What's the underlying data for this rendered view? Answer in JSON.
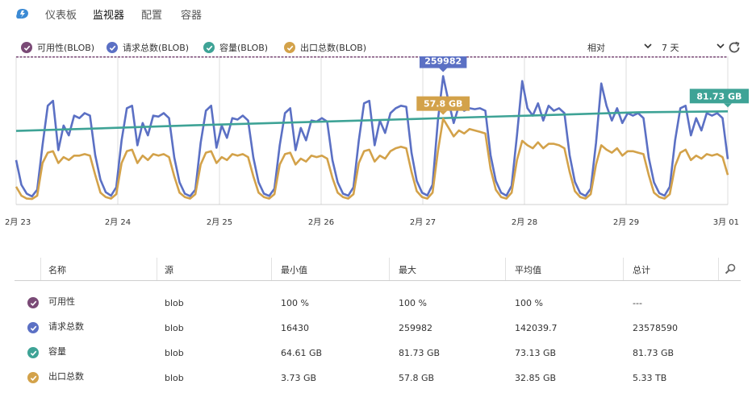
{
  "nav": {
    "tabs": [
      "仪表板",
      "监视器",
      "配置",
      "容器"
    ],
    "active": 1
  },
  "legend": [
    {
      "label": "可用性(BLOB)",
      "color": "#7a4a76"
    },
    {
      "label": "请求总数(BLOB)",
      "color": "#5b70c4"
    },
    {
      "label": "容量(BLOB)",
      "color": "#3ea396"
    },
    {
      "label": "出口总数(BLOB)",
      "color": "#d3a24a"
    }
  ],
  "controls": {
    "mode": "相对",
    "range": "7 天"
  },
  "chart_data": {
    "type": "line",
    "x_ticks": [
      "2月 23",
      "2月 24",
      "2月 25",
      "2月 26",
      "2月 27",
      "2月 28",
      "2月 29",
      "3月 01"
    ],
    "series": [
      {
        "name": "可用性(BLOB)",
        "unit": "%",
        "values": [
          100,
          100,
          100,
          100,
          100,
          100,
          100,
          100,
          100,
          100,
          100,
          100,
          100,
          100,
          100,
          100
        ]
      },
      {
        "name": "请求总数(BLOB)",
        "values": [
          90000,
          40000,
          22000,
          16430,
          30000,
          120000,
          200000,
          210000,
          110000,
          160000,
          140000,
          180000,
          175000,
          185000,
          180000,
          100000,
          50000,
          25000,
          18000,
          35000,
          130000,
          195000,
          200000,
          120000,
          165000,
          140000,
          180000,
          178000,
          185000,
          175000,
          95000,
          45000,
          22000,
          17000,
          30000,
          125000,
          190000,
          200000,
          115000,
          160000,
          135000,
          175000,
          172000,
          180000,
          170000,
          95000,
          45000,
          22000,
          17500,
          32000,
          120000,
          185000,
          195000,
          110000,
          155000,
          130000,
          170000,
          168000,
          175000,
          168000,
          90000,
          45000,
          22000,
          18000,
          35000,
          130000,
          205000,
          210000,
          120000,
          170000,
          145000,
          185000,
          195000,
          200000,
          198000,
          105000,
          48000,
          24000,
          18500,
          40000,
          170000,
          259982,
          210000,
          165000,
          200000,
          190000,
          195000,
          193000,
          195000,
          190000,
          100000,
          48000,
          24000,
          18000,
          38000,
          140000,
          250000,
          195000,
          180000,
          205000,
          170000,
          200000,
          190000,
          195000,
          185000,
          100000,
          46000,
          23000,
          17500,
          32000,
          125000,
          245000,
          200000,
          170000,
          195000,
          165000,
          185000,
          180000,
          185000,
          175000,
          95000,
          45000,
          23000,
          18000,
          36000,
          130000,
          195000,
          200000,
          140000,
          175000,
          150000,
          185000,
          180000,
          185000,
          175000,
          92000
        ]
      },
      {
        "name": "容量(BLOB)",
        "unit": "GB",
        "values": [
          64.61,
          67.0,
          69.5,
          71.8,
          74.0,
          76.3,
          78.6,
          81.0,
          81.73
        ]
      },
      {
        "name": "出口总数(BLOB)",
        "unit": "GB",
        "values": [
          12,
          6,
          4,
          3.73,
          6,
          28,
          35,
          36,
          28,
          32,
          30,
          33,
          33,
          34,
          33,
          20,
          8,
          5,
          4,
          7,
          28,
          36,
          37,
          28,
          33,
          30,
          34,
          33,
          34,
          32,
          19,
          8,
          5,
          4,
          7,
          27,
          35,
          36,
          28,
          32,
          30,
          34,
          33,
          34,
          32,
          19,
          8,
          5,
          4,
          7,
          27,
          34,
          35,
          27,
          31,
          29,
          33,
          32,
          33,
          31,
          18,
          8,
          5,
          4,
          7,
          28,
          36,
          37,
          29,
          33,
          31,
          36,
          38,
          39,
          38,
          22,
          9,
          5,
          4,
          8,
          36,
          57.8,
          52,
          46,
          50,
          48,
          51,
          50,
          49,
          48,
          24,
          10,
          5,
          4,
          8,
          30,
          43,
          40,
          38,
          42,
          38,
          41,
          41,
          40,
          38,
          22,
          9,
          5,
          4,
          7,
          27,
          40,
          37,
          35,
          38,
          33,
          36,
          36,
          35,
          34,
          20,
          8,
          5,
          4,
          7,
          26,
          35,
          37,
          30,
          33,
          31,
          34,
          33,
          34,
          32,
          20
        ]
      }
    ],
    "y_scales": {
      "requests": [
        0,
        300000
      ],
      "availability": [
        0,
        100
      ],
      "capacity_gb": [
        0,
        130
      ],
      "egress_gb": [
        0,
        100
      ]
    },
    "callouts": [
      {
        "text": "100 %",
        "series": 0,
        "index": 15
      },
      {
        "text": "259982",
        "series": 1,
        "index": 81
      },
      {
        "text": "81.73 GB",
        "series": 2,
        "index": 8
      },
      {
        "text": "57.8 GB",
        "series": 3,
        "index": 81
      }
    ],
    "grid": true
  },
  "table": {
    "headers": [
      "名称",
      "源",
      "最小值",
      "最大",
      "平均值",
      "总计"
    ],
    "rows": [
      {
        "color": "#7a4a76",
        "cells": [
          "可用性",
          "blob",
          "100 %",
          "100 %",
          "100 %",
          "---"
        ]
      },
      {
        "color": "#5b70c4",
        "cells": [
          "请求总数",
          "blob",
          "16430",
          "259982",
          "142039.7",
          "23578590"
        ]
      },
      {
        "color": "#3ea396",
        "cells": [
          "容量",
          "blob",
          "64.61 GB",
          "81.73 GB",
          "73.13 GB",
          "81.73 GB"
        ]
      },
      {
        "color": "#d3a24a",
        "cells": [
          "出口总数",
          "blob",
          "3.73 GB",
          "57.8 GB",
          "32.85 GB",
          "5.33 TB"
        ]
      }
    ]
  }
}
